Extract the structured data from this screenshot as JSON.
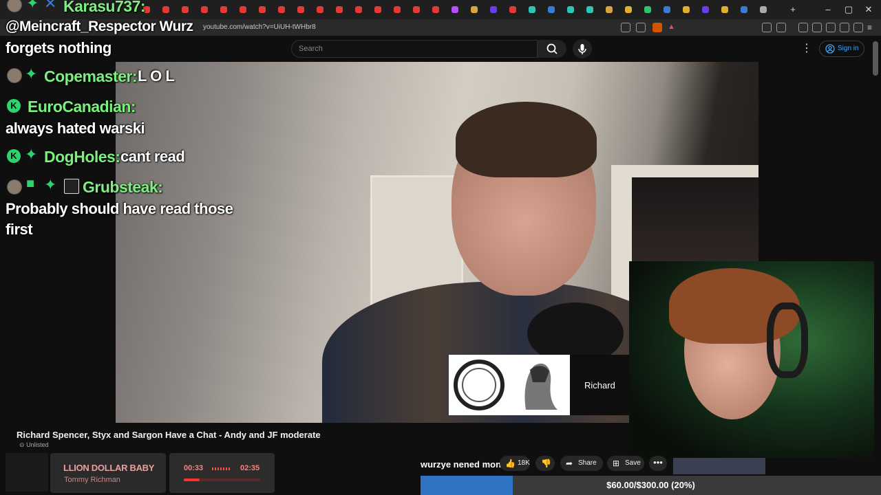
{
  "browser": {
    "url": "youtube.com/watch?v=UiUH-tWHbr8",
    "tab_colors": [
      "#e53935",
      "#e53935",
      "#e53935",
      "#e53935",
      "#e53935",
      "#e53935",
      "#e53935",
      "#e53935",
      "#e53935",
      "#e53935",
      "#e53935",
      "#e53935",
      "#e53935",
      "#e53935",
      "#e53935",
      "#e53935",
      "#b84dff",
      "#d8a640",
      "#6a3df0",
      "#e53935",
      "#2ec4b6",
      "#3a7bd5",
      "#2ec4b6",
      "#2ec4b6",
      "#d8a640",
      "#e0b030",
      "#2ec46b",
      "#3a7bd5",
      "#e0b030",
      "#6a3df0",
      "#e0b030",
      "#3a7bd5",
      "#aaaaaa"
    ],
    "new_tab_label": "+",
    "minimize_label": "–",
    "maximize_label": "▢",
    "close_label": "✕"
  },
  "youtube": {
    "search_placeholder": "Search",
    "signin_label": "Sign in",
    "more_label": "⋮",
    "video_title": "Richard Spencer, Styx and Sargon Have a Chat - Andy and JF moderate",
    "unlisted_label": "Unlisted",
    "likes": "18K",
    "share_label": "Share",
    "save_label": "Save",
    "more_actions_label": "•••"
  },
  "video_overlay": {
    "name": "Richard"
  },
  "chat": [
    {
      "user": "Karasu737:",
      "message": ""
    },
    {
      "user": "@Meincraft_Respector Wurz",
      "message": "forgets nothing"
    },
    {
      "user": "Copemaster:",
      "message": "L O L"
    },
    {
      "user": "EuroCanadian:",
      "message": "always hated warski"
    },
    {
      "user": "DogHoles:",
      "message": "cant read"
    },
    {
      "user": "Grubsteak:",
      "message": "Probably should have read those",
      "message2": "first"
    }
  ],
  "music": {
    "title": "LLION DOLLAR BABY",
    "artist": "Tommy Richman",
    "time_now": "00:33",
    "time_end": "02:35",
    "progress": 0.21
  },
  "tts_message": "wurzye nened money",
  "donation_goal": {
    "label": "$60.00/$300.00 (20%)",
    "progress": 0.2,
    "color": "#2f74c2"
  }
}
